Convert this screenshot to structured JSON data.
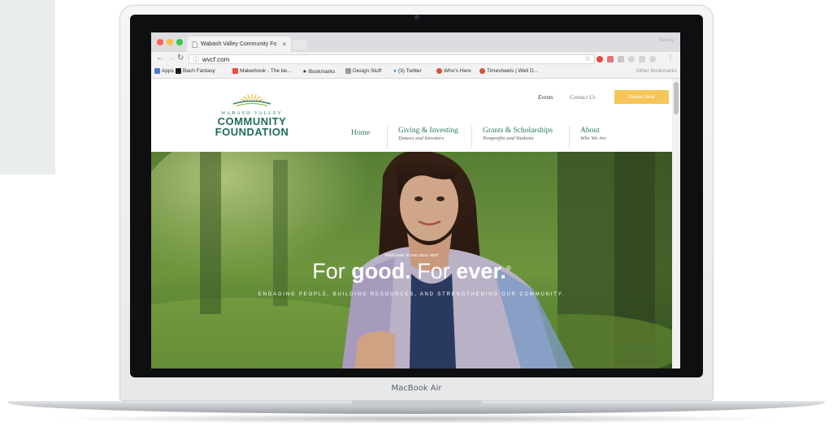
{
  "device": {
    "label": "MacBook Air"
  },
  "browser": {
    "tab_title": "Wabash Valley Community Fo",
    "tab_close": "×",
    "profile_label": "Betsey",
    "url": "wvcf.com",
    "bookmarks": [
      {
        "label": "Apps",
        "color": "#4a7bd0"
      },
      {
        "label": "Bach Fantasy",
        "color": "#1b1b1b"
      },
      {
        "label": "Makerbook - The be...",
        "color": "#e74c3c"
      },
      {
        "label": "Bookmarks",
        "color": "#555555"
      },
      {
        "label": "Design Stuff",
        "color": "#9a9a9a"
      },
      {
        "label": "(3) Twitter",
        "color": "#1da1f2"
      },
      {
        "label": "Who's Here",
        "color": "#e04a3f"
      },
      {
        "label": "Timesheets | Well D...",
        "color": "#e04a3f"
      }
    ],
    "other_bookmarks": "Other Bookmarks"
  },
  "site": {
    "logo": {
      "top_text": "WABASH VALLEY",
      "line1": "COMMUNITY",
      "line2": "FOUNDATION"
    },
    "utility_nav": {
      "events": "Events",
      "contact": "Contact Us",
      "donate": "Donate Now"
    },
    "nav": [
      {
        "label": "Home",
        "sub": ""
      },
      {
        "label": "Giving & Investing",
        "sub": "Donors and Investors"
      },
      {
        "label": "Grants & Scholarships",
        "sub": "Nonprofits and Students"
      },
      {
        "label": "About",
        "sub": "Who We Are"
      }
    ],
    "hero": {
      "welcome": "Welcome to our new site!",
      "title_part1": "For ",
      "title_bold1": "good.",
      "title_part2": " For ",
      "title_bold2": "ever.",
      "title_mark": "®",
      "tagline": "ENGAGING PEOPLE, BUILDING RESOURCES, AND STRENGTHENING OUR COMMUNITY."
    }
  },
  "colors": {
    "brand_green": "#1f6b5a",
    "donate_yellow": "#f6c65a"
  }
}
